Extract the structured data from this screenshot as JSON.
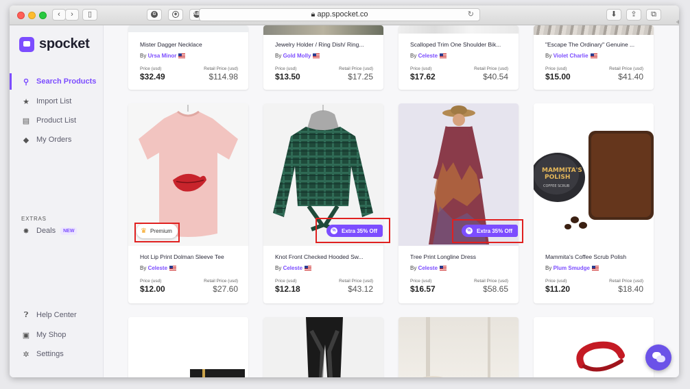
{
  "browser": {
    "url": "app.spocket.co",
    "lock_icon": "lock-icon",
    "new_tab_label": "+"
  },
  "sidebar": {
    "brand": "spocket",
    "nav": [
      {
        "icon": "search-icon",
        "label": "Search Products",
        "active": true
      },
      {
        "icon": "star-icon",
        "label": "Import List",
        "active": false
      },
      {
        "icon": "list-icon",
        "label": "Product List",
        "active": false
      },
      {
        "icon": "tag-icon",
        "label": "My Orders",
        "active": false
      }
    ],
    "extras_label": "EXTRAS",
    "deals": {
      "icon": "deals-icon",
      "label": "Deals",
      "badge": "NEW"
    },
    "bottom": [
      {
        "icon": "help-icon",
        "label": "Help Center"
      },
      {
        "icon": "shop-icon",
        "label": "My Shop"
      },
      {
        "icon": "gear-icon",
        "label": "Settings"
      }
    ]
  },
  "labels": {
    "price": "Price (usd)",
    "retail": "Retail Price (usd)",
    "by": "By"
  },
  "products_row1": [
    {
      "title": "Mister Dagger Necklace",
      "seller": "Ursa Minor",
      "price": "$32.49",
      "retail": "$114.98"
    },
    {
      "title": "Jewelry Holder / Ring Dish/ Ring...",
      "seller": "Gold Molly",
      "price": "$13.50",
      "retail": "$17.25"
    },
    {
      "title": "Scalloped Trim One Shoulder Bik...",
      "seller": "Celeste",
      "price": "$17.62",
      "retail": "$40.54"
    },
    {
      "title": "\"Escape The Ordinary\" Genuine ...",
      "seller": "Violet Charlie",
      "price": "$15.00",
      "retail": "$41.40"
    }
  ],
  "products_row2": [
    {
      "title": "Hot Lip Print Dolman Sleeve Tee",
      "seller": "Celeste",
      "price": "$12.00",
      "retail": "$27.60",
      "badge": "Premium"
    },
    {
      "title": "Knot Front Checked Hooded Sw...",
      "seller": "Celeste",
      "price": "$12.18",
      "retail": "$43.12",
      "badge": "Extra 35% Off"
    },
    {
      "title": "Tree Print Longline Dress",
      "seller": "Celeste",
      "price": "$16.57",
      "retail": "$58.65",
      "badge": "Extra 35% Off"
    },
    {
      "title": "Mammita's Coffee Scrub Polish",
      "seller": "Plum Smudge",
      "price": "$11.20",
      "retail": "$18.40"
    }
  ],
  "product_images": {
    "jar_label_line1": "MAMMITA'S",
    "jar_label_line2": "POLISH",
    "jar_label_line3": "COFFEE SCRUB"
  },
  "colors": {
    "accent": "#7c4dff",
    "highlight": "#e0201f"
  }
}
